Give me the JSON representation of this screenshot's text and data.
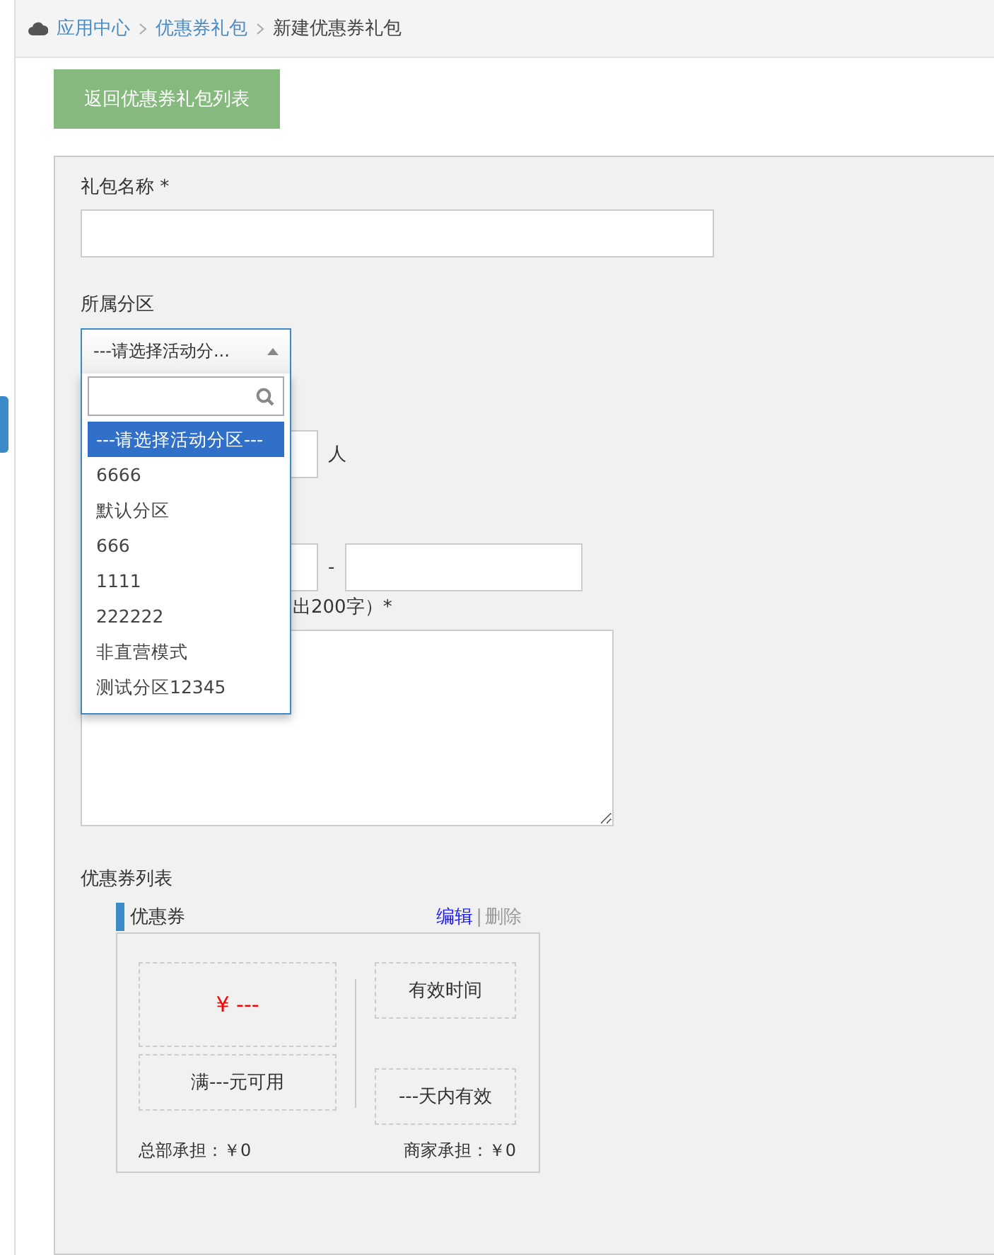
{
  "breadcrumb": [
    {
      "label": "应用中心",
      "kind": "link"
    },
    {
      "label": "优惠券礼包",
      "kind": "link"
    },
    {
      "label": "新建优惠券礼包",
      "kind": "current"
    }
  ],
  "back_button": "返回优惠券礼包列表",
  "name_field": {
    "label": "礼包名称 *"
  },
  "zone_field": {
    "label": "所属分区",
    "value": "---请选择活动分...",
    "expanded": true,
    "options": [
      {
        "label": "---请选择活动分区---",
        "selected": true
      },
      {
        "label": "6666",
        "selected": false
      },
      {
        "label": "默认分区",
        "selected": false
      },
      {
        "label": "666",
        "selected": false
      },
      {
        "label": "1111",
        "selected": false
      },
      {
        "label": "222222",
        "selected": false
      },
      {
        "label": "非直营模式",
        "selected": false
      },
      {
        "label": "测试分区12345",
        "selected": false
      }
    ]
  },
  "people_field": {
    "unit": "人"
  },
  "date_field": {
    "separator": "-"
  },
  "description_field": {
    "label": "出200字）*"
  },
  "coupon_list": {
    "label": "优惠券列表",
    "title": "优惠券",
    "edit": "编辑",
    "separator": "|",
    "delete": "删除",
    "card": {
      "amount": "¥ ---",
      "condition": "满---元可用",
      "validity_label": "有效时间",
      "validity": "---天内有效",
      "hq_share": "总部承担：￥0",
      "merchant_share": "商家承担：￥0"
    }
  }
}
